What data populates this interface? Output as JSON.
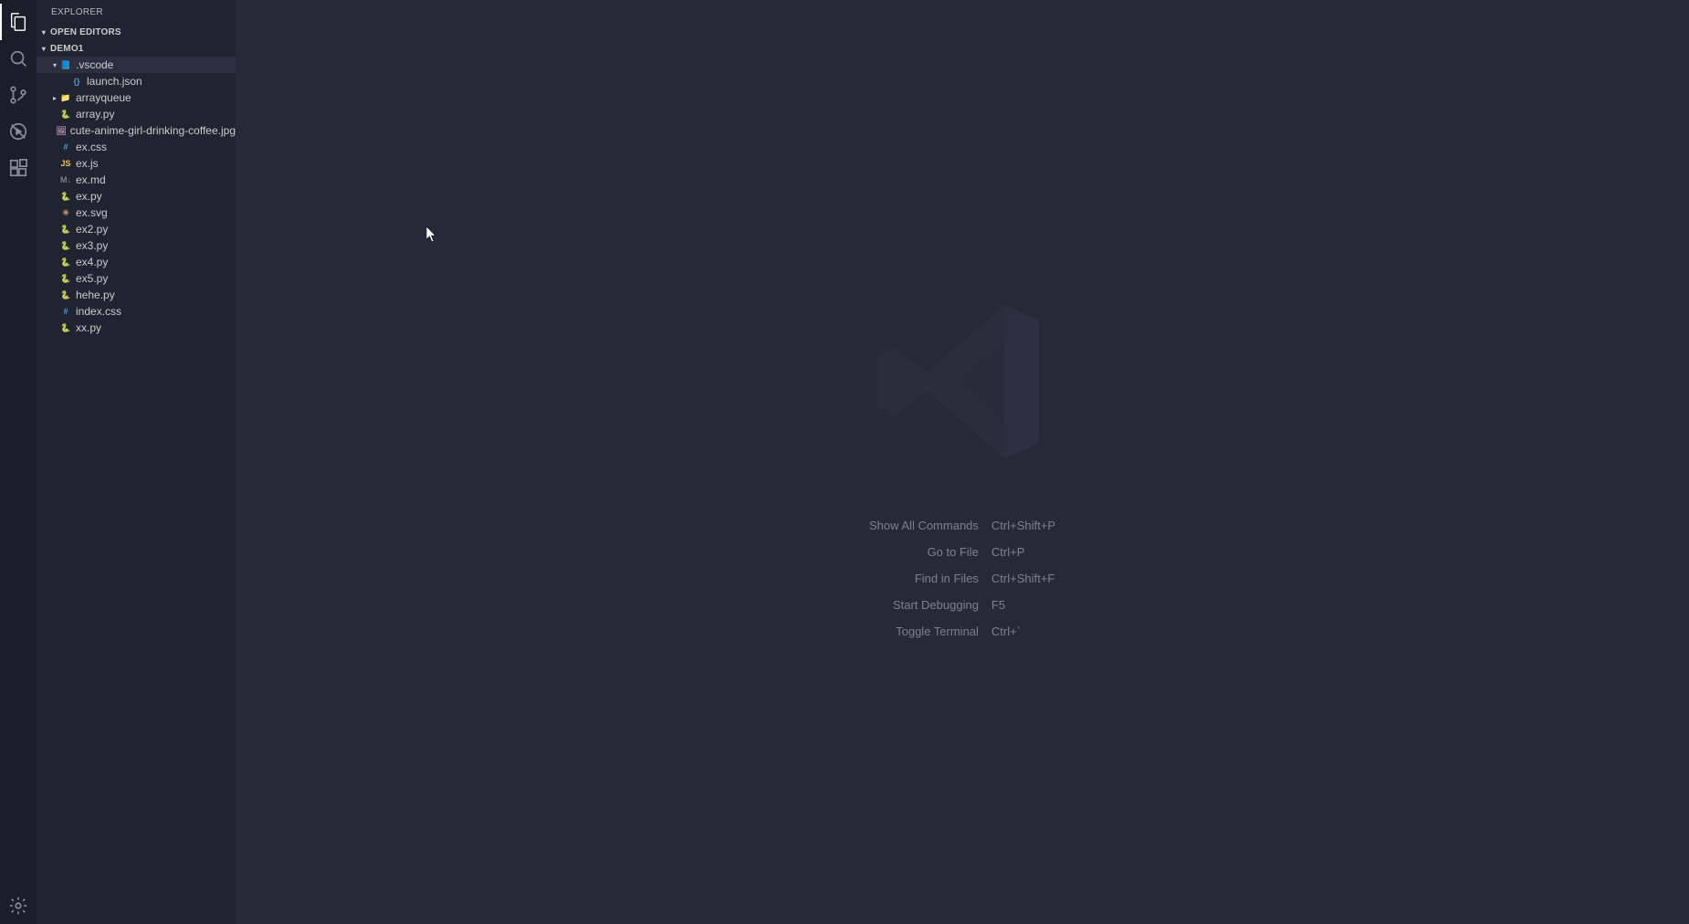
{
  "sidebar": {
    "title": "EXPLORER",
    "sections": {
      "open_editors": "OPEN EDITORS",
      "workspace": "DEMO1"
    }
  },
  "tree": [
    {
      "name": ".vscode",
      "type": "folder-vscode",
      "indent": 1,
      "expanded": true,
      "selected": true
    },
    {
      "name": "launch.json",
      "type": "json",
      "indent": 2
    },
    {
      "name": "arrayqueue",
      "type": "folder",
      "indent": 1,
      "expanded": false
    },
    {
      "name": "array.py",
      "type": "py",
      "indent": 1
    },
    {
      "name": "cute-anime-girl-drinking-coffee.jpg",
      "type": "img",
      "indent": 1
    },
    {
      "name": "ex.css",
      "type": "css",
      "indent": 1
    },
    {
      "name": "ex.js",
      "type": "js",
      "indent": 1
    },
    {
      "name": "ex.md",
      "type": "md",
      "indent": 1
    },
    {
      "name": "ex.py",
      "type": "py",
      "indent": 1
    },
    {
      "name": "ex.svg",
      "type": "svg",
      "indent": 1
    },
    {
      "name": "ex2.py",
      "type": "py",
      "indent": 1
    },
    {
      "name": "ex3.py",
      "type": "py",
      "indent": 1
    },
    {
      "name": "ex4.py",
      "type": "py",
      "indent": 1
    },
    {
      "name": "ex5.py",
      "type": "py",
      "indent": 1
    },
    {
      "name": "hehe.py",
      "type": "py",
      "indent": 1
    },
    {
      "name": "index.css",
      "type": "css",
      "indent": 1
    },
    {
      "name": "xx.py",
      "type": "py",
      "indent": 1
    }
  ],
  "welcome": {
    "shortcuts": [
      {
        "label": "Show All Commands",
        "kbd": "Ctrl+Shift+P"
      },
      {
        "label": "Go to File",
        "kbd": "Ctrl+P"
      },
      {
        "label": "Find in Files",
        "kbd": "Ctrl+Shift+F"
      },
      {
        "label": "Start Debugging",
        "kbd": "F5"
      },
      {
        "label": "Toggle Terminal",
        "kbd": "Ctrl+`"
      }
    ]
  },
  "icons": {
    "py": "🐍",
    "js": "JS",
    "css": "#",
    "json": "{}",
    "md": "M↓",
    "img": "🖼",
    "svg": "✳",
    "folder": "📁",
    "folder-vscode": "📘"
  }
}
